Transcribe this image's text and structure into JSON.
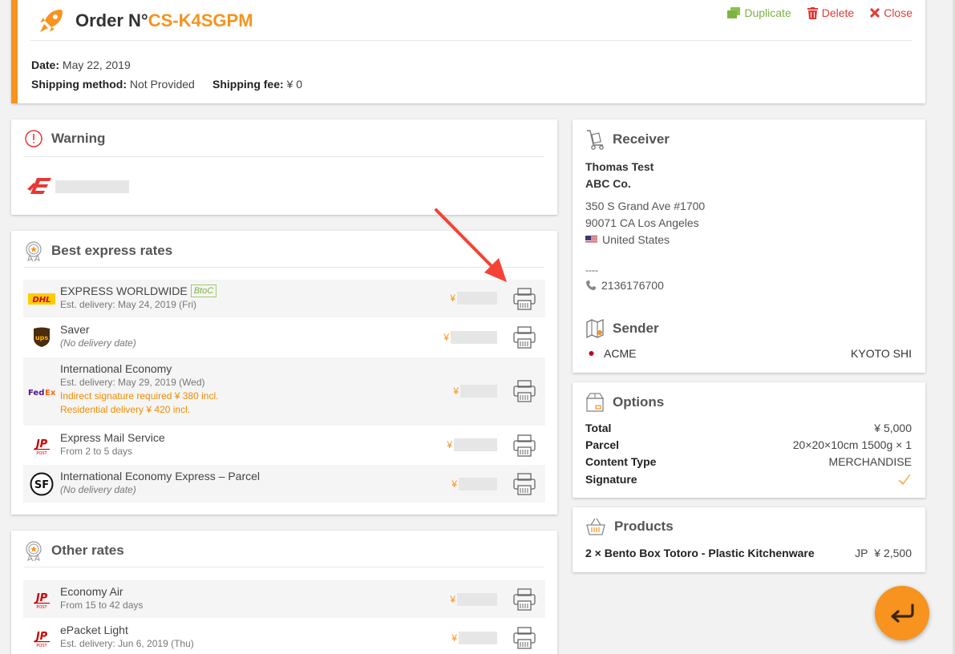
{
  "header": {
    "title_prefix": "Order N°",
    "order_id": "CS-K4SGPM",
    "duplicate": "Duplicate",
    "delete": "Delete",
    "close": "Close",
    "date_label": "Date:",
    "date_value": "May 22, 2019",
    "shipping_method_label": "Shipping method:",
    "shipping_method_value": "Not Provided",
    "shipping_fee_label": "Shipping fee:",
    "shipping_fee_value": "¥ 0"
  },
  "warning": {
    "title": "Warning"
  },
  "best_rates": {
    "title": "Best express rates",
    "currency": "¥",
    "rows": [
      {
        "carrier": "DHL",
        "name": "EXPRESS WORLDWIDE",
        "badge": "BtoC",
        "sub": "Est. delivery: May 24, 2019 (Fri)",
        "warnings": []
      },
      {
        "carrier": "UPS",
        "name": "Saver",
        "badge": "",
        "sub": "(No delivery date)",
        "warnings": []
      },
      {
        "carrier": "FedEx",
        "name": "International Economy",
        "badge": "",
        "sub": "Est. delivery: May 29, 2019 (Wed)",
        "warnings": [
          "Indirect signature required ¥ 380 incl.",
          "Residential delivery ¥ 420 incl."
        ]
      },
      {
        "carrier": "JP",
        "name": "Express Mail Service",
        "badge": "",
        "sub": "From 2 to 5 days",
        "warnings": []
      },
      {
        "carrier": "SF",
        "name": "International Economy Express – Parcel",
        "badge": "",
        "sub": "(No delivery date)",
        "warnings": []
      }
    ]
  },
  "other_rates": {
    "title": "Other rates",
    "currency": "¥",
    "rows": [
      {
        "carrier": "JP",
        "name": "Economy Air",
        "sub": "From 15 to 42 days"
      },
      {
        "carrier": "JP",
        "name": "ePacket Light",
        "sub": "Est. delivery: Jun 6, 2019 (Thu)"
      }
    ]
  },
  "receiver": {
    "title": "Receiver",
    "name": "Thomas Test",
    "company": "ABC Co.",
    "address1": "350 S Grand Ave #1700",
    "address2": "90071 CA Los Angeles",
    "country": "United States",
    "dashes": "----",
    "phone": "2136176700"
  },
  "sender": {
    "title": "Sender",
    "name": "ACME",
    "city": "KYOTO SHI"
  },
  "options": {
    "title": "Options",
    "rows": [
      {
        "key": "Total",
        "value": "¥ 5,000"
      },
      {
        "key": "Parcel",
        "value": "20×20×10cm 1500g × 1"
      },
      {
        "key": "Content Type",
        "value": "MERCHANDISE"
      }
    ],
    "signature_label": "Signature"
  },
  "products": {
    "title": "Products",
    "item": "2 × Bento Box Totoro - Plastic Kitchenware",
    "origin": "JP",
    "price": "¥ 2,500"
  },
  "colors": {
    "accent": "#f7931e",
    "green": "#7cb342",
    "red": "#e53935",
    "arrow": "#f44336"
  }
}
